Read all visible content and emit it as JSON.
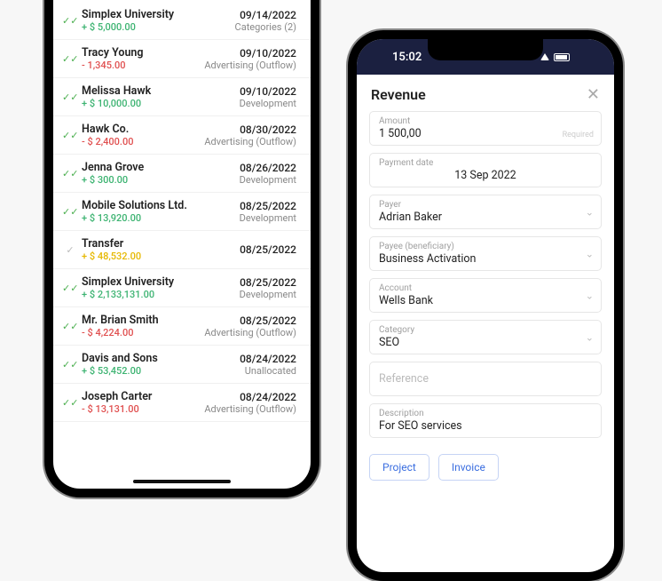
{
  "left_phone": {
    "transactions": [
      {
        "title": "Simplex University",
        "amount": "+ $ 5,000.00",
        "tone": "pos",
        "date": "09/14/2022",
        "category": "Categories (2)",
        "check": "dbl"
      },
      {
        "title": "Tracy Young",
        "amount": "- 1,345.00",
        "tone": "neg",
        "date": "09/10/2022",
        "category": "Advertising (Outflow)",
        "check": "dbl"
      },
      {
        "title": "Melissa Hawk",
        "amount": "+ $ 10,000.00",
        "tone": "pos",
        "date": "09/10/2022",
        "category": "Development",
        "check": "dbl"
      },
      {
        "title": "Hawk Co.",
        "amount": "- $ 2,400.00",
        "tone": "neg",
        "date": "08/30/2022",
        "category": "Advertising (Outflow)",
        "check": "dbl"
      },
      {
        "title": "Jenna Grove",
        "amount": "+ $ 300.00",
        "tone": "pos",
        "date": "08/26/2022",
        "category": "Development",
        "check": "dbl"
      },
      {
        "title": "Mobile Solutions Ltd.",
        "amount": "+ $ 13,920.00",
        "tone": "pos",
        "date": "08/25/2022",
        "category": "Development",
        "check": "dbl"
      },
      {
        "title": "Transfer",
        "amount": "+ $ 48,532.00",
        "tone": "yel",
        "date": "08/25/2022",
        "category": "",
        "check": "single"
      },
      {
        "title": "Simplex University",
        "amount": "+ $ 2,133,131.00",
        "tone": "pos",
        "date": "08/25/2022",
        "category": "Development",
        "check": "dbl"
      },
      {
        "title": "Mr. Brian Smith",
        "amount": "- $ 4,224.00",
        "tone": "neg",
        "date": "08/25/2022",
        "category": "Advertising (Outflow)",
        "check": "dbl"
      },
      {
        "title": "Davis and Sons",
        "amount": "+ $ 53,452.00",
        "tone": "pos",
        "date": "08/24/2022",
        "category": "Unallocated",
        "check": "dbl"
      },
      {
        "title": "Joseph Carter",
        "amount": "- $ 13,131.00",
        "tone": "neg",
        "date": "08/24/2022",
        "category": "Advertising (Outflow)",
        "check": "dbl"
      }
    ]
  },
  "right_phone": {
    "statusbar_time": "15:02",
    "header_title": "Revenue",
    "amount": {
      "label": "Amount",
      "value": "1 500,00",
      "required_hint": "Required"
    },
    "payment_date": {
      "label": "Payment date",
      "value": "13 Sep 2022"
    },
    "payer": {
      "label": "Payer",
      "value": "Adrian Baker"
    },
    "payee": {
      "label": "Payee (beneficiary)",
      "value": "Business Activation"
    },
    "account": {
      "label": "Account",
      "value": "Wells Bank"
    },
    "category": {
      "label": "Category",
      "value": "SEO"
    },
    "reference": {
      "placeholder": "Reference"
    },
    "description": {
      "label": "Description",
      "value": "For SEO services"
    },
    "buttons": {
      "project": "Project",
      "invoice": "Invoice"
    }
  }
}
